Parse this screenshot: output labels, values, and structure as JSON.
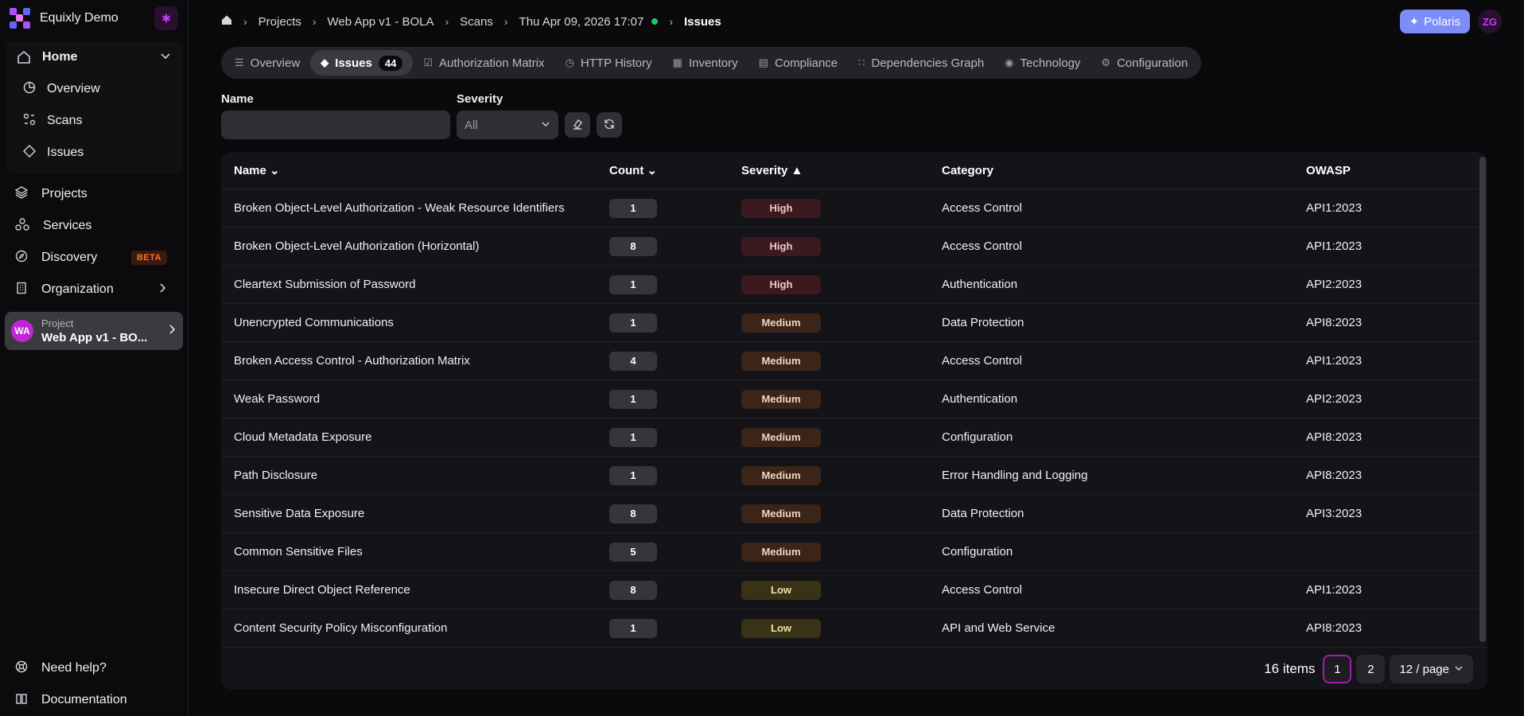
{
  "brand": {
    "name": "Equixly Demo"
  },
  "nav": {
    "home": "Home",
    "sub": [
      "Overview",
      "Scans",
      "Issues"
    ],
    "projects": "Projects",
    "services": "Services",
    "discovery": "Discovery",
    "beta": "BETA",
    "organization": "Organization",
    "project_card": {
      "initials": "WA",
      "label": "Project",
      "name": "Web App v1 - BO..."
    },
    "help": "Need help?",
    "docs": "Documentation"
  },
  "breadcrumb": {
    "projects": "Projects",
    "project": "Web App v1 - BOLA",
    "scans": "Scans",
    "scan": "Thu Apr 09, 2026 17:07",
    "current": "Issues"
  },
  "topright": {
    "polaris": "Polaris",
    "avatar": "ZG"
  },
  "tabs": [
    {
      "label": "Overview",
      "icon": "overview-icon"
    },
    {
      "label": "Issues",
      "icon": "issues-icon",
      "count": "44"
    },
    {
      "label": "Authorization Matrix",
      "icon": "checkbox-icon"
    },
    {
      "label": "HTTP History",
      "icon": "clock-icon"
    },
    {
      "label": "Inventory",
      "icon": "table-icon"
    },
    {
      "label": "Compliance",
      "icon": "clipboard-icon"
    },
    {
      "label": "Dependencies Graph",
      "icon": "graph-icon"
    },
    {
      "label": "Technology",
      "icon": "cpu-icon"
    },
    {
      "label": "Configuration",
      "icon": "gear-icon"
    }
  ],
  "filters": {
    "name_label": "Name",
    "name_value": "",
    "severity_label": "Severity",
    "severity_value": "All"
  },
  "table": {
    "headers": {
      "name": "Name",
      "count": "Count",
      "severity": "Severity",
      "category": "Category",
      "owasp": "OWASP"
    },
    "rows": [
      {
        "name": "Broken Object-Level Authorization - Weak Resource Identifiers",
        "count": "1",
        "severity": "High",
        "category": "Access Control",
        "owasp": "API1:2023"
      },
      {
        "name": "Broken Object-Level Authorization (Horizontal)",
        "count": "8",
        "severity": "High",
        "category": "Access Control",
        "owasp": "API1:2023"
      },
      {
        "name": "Cleartext Submission of Password",
        "count": "1",
        "severity": "High",
        "category": "Authentication",
        "owasp": "API2:2023"
      },
      {
        "name": "Unencrypted Communications",
        "count": "1",
        "severity": "Medium",
        "category": "Data Protection",
        "owasp": "API8:2023"
      },
      {
        "name": "Broken Access Control - Authorization Matrix",
        "count": "4",
        "severity": "Medium",
        "category": "Access Control",
        "owasp": "API1:2023"
      },
      {
        "name": "Weak Password",
        "count": "1",
        "severity": "Medium",
        "category": "Authentication",
        "owasp": "API2:2023"
      },
      {
        "name": "Cloud Metadata Exposure",
        "count": "1",
        "severity": "Medium",
        "category": "Configuration",
        "owasp": "API8:2023"
      },
      {
        "name": "Path Disclosure",
        "count": "1",
        "severity": "Medium",
        "category": "Error Handling and Logging",
        "owasp": "API8:2023"
      },
      {
        "name": "Sensitive Data Exposure",
        "count": "8",
        "severity": "Medium",
        "category": "Data Protection",
        "owasp": "API3:2023"
      },
      {
        "name": "Common Sensitive Files",
        "count": "5",
        "severity": "Medium",
        "category": "Configuration",
        "owasp": ""
      },
      {
        "name": "Insecure Direct Object Reference",
        "count": "8",
        "severity": "Low",
        "category": "Access Control",
        "owasp": "API1:2023"
      },
      {
        "name": "Content Security Policy Misconfiguration",
        "count": "1",
        "severity": "Low",
        "category": "API and Web Service",
        "owasp": "API8:2023"
      }
    ]
  },
  "pagination": {
    "total": "16 items",
    "pages": [
      "1",
      "2"
    ],
    "per_page": "12 / page"
  },
  "colors": {
    "accent": "#c026d3",
    "polaris": "#7c8cf8",
    "status_ok": "#22c55e"
  }
}
